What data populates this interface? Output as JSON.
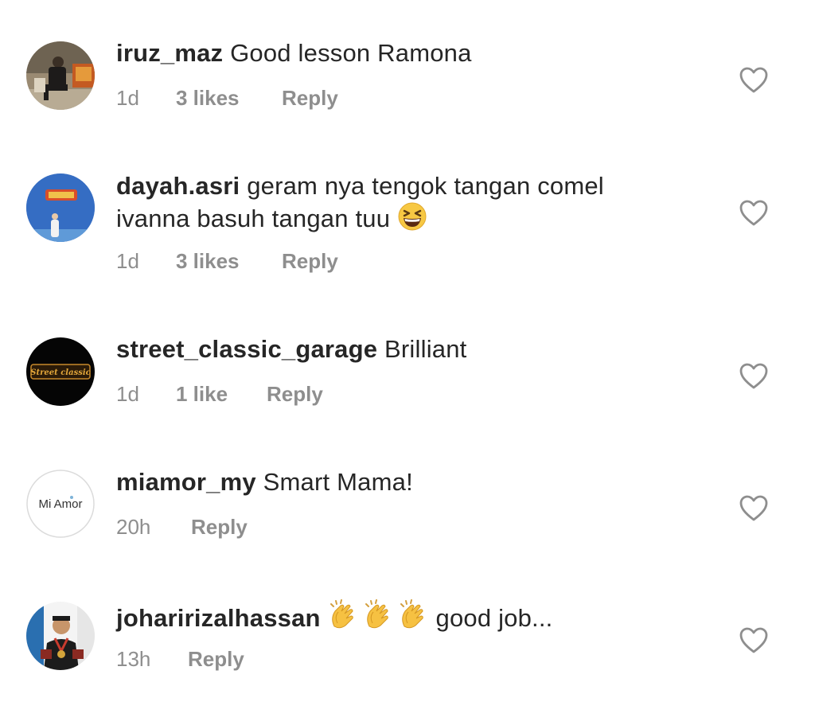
{
  "comments": [
    {
      "username": "iruz_maz",
      "text": "Good lesson Ramona",
      "time": "1d",
      "likes": "3 likes",
      "reply": "Reply",
      "avatar": "photo-man-sitting-icon"
    },
    {
      "username": "dayah.asri",
      "text_line1": "geram nya tengok tangan comel",
      "text_line2": "ivanna basuh tangan tuu",
      "emoji": "grinning-squinting-face-icon",
      "time": "1d",
      "likes": "3 likes",
      "reply": "Reply",
      "avatar": "photo-person-blue-wall-icon"
    },
    {
      "username": "street_classic_garage",
      "text": "Brilliant",
      "time": "1d",
      "likes": "1 like",
      "reply": "Reply",
      "avatar": "garage-logo-icon",
      "avatar_logo_text": "Street classic"
    },
    {
      "username": "miamor_my",
      "text": "Smart Mama!",
      "time": "20h",
      "reply": "Reply",
      "avatar": "mi-amor-logo-icon",
      "avatar_logo_text": "Mi Amor"
    },
    {
      "username": "joharirizalhassan",
      "emoji": "clapping-hands-icon",
      "text": "good job...",
      "time": "13h",
      "reply": "Reply",
      "avatar": "photo-man-with-medal-icon"
    }
  ],
  "colors": {
    "text": "#262626",
    "meta": "#8e8e8e",
    "heart_stroke": "#8e8e8e"
  }
}
